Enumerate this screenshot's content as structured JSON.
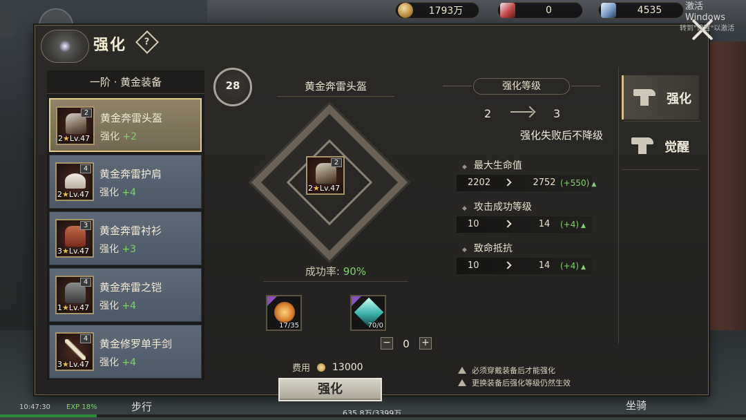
{
  "currencies": [
    {
      "icon": "gold-coin-icon",
      "value": "1793万"
    },
    {
      "icon": "red-gem-icon",
      "value": "0"
    },
    {
      "icon": "crystal-icon",
      "value": "4535"
    }
  ],
  "panel": {
    "title": "强化",
    "help_icon": "?"
  },
  "equip_list": {
    "header": "一阶 · 黄金装备",
    "items": [
      {
        "name": "黄金奔雷头盔",
        "enh_prefix": "强化",
        "enh_value": "+2",
        "badge": "2",
        "stars": "2",
        "level": "Lv.47",
        "selected": true
      },
      {
        "name": "黄金奔雷护肩",
        "enh_prefix": "强化",
        "enh_value": "+4",
        "badge": "4",
        "stars": "2",
        "level": "Lv.47",
        "selected": false
      },
      {
        "name": "黄金奔雷衬衫",
        "enh_prefix": "强化",
        "enh_value": "+3",
        "badge": "3",
        "stars": "3",
        "level": "Lv.47",
        "selected": false
      },
      {
        "name": "黄金奔雷之铠",
        "enh_prefix": "强化",
        "enh_value": "+4",
        "badge": "4",
        "stars": "1",
        "level": "Lv.47",
        "selected": false
      },
      {
        "name": "黄金修罗单手剑",
        "enh_prefix": "强化",
        "enh_value": "+4",
        "badge": "4",
        "stars": "3",
        "level": "Lv.47",
        "selected": false
      }
    ]
  },
  "center": {
    "rank": "28",
    "item_title": "黄金奔雷头盔",
    "slot": {
      "badge": "2",
      "stars": "2",
      "level": "Lv.47"
    },
    "success_label": "成功率:",
    "success_value": "90%",
    "materials": [
      {
        "icon": "gold-stone-icon",
        "count": "17/35"
      },
      {
        "icon": "blue-crystal-icon",
        "count": "70/0"
      }
    ],
    "stepper": {
      "minus": "−",
      "value": "0",
      "plus": "+"
    },
    "cost_label": "费用",
    "cost_value": "13000",
    "enhance_button": "强化"
  },
  "stats": {
    "header": "强化等级",
    "from_level": "2",
    "to_level": "3",
    "no_drop_text": "强化失败后不降级",
    "rows": [
      {
        "label": "最大生命值",
        "current": "2202",
        "next": "2752",
        "diff": "(+550)"
      },
      {
        "label": "攻击成功等级",
        "current": "10",
        "next": "14",
        "diff": "(+4)"
      },
      {
        "label": "致命抵抗",
        "current": "10",
        "next": "14",
        "diff": "(+4)"
      }
    ],
    "notes": [
      "必须穿戴装备后才能强化",
      "更换装备后强化等级仍然生效"
    ]
  },
  "tabs": [
    {
      "label": "强化",
      "icon": "anvil-icon",
      "active": true
    },
    {
      "label": "觉醒",
      "icon": "anvil-icon",
      "active": false
    }
  ],
  "hud": {
    "time": "10:47:30",
    "exp": "EXP 18%",
    "walk": "步行",
    "progress": "635.8万/3399万",
    "mount": "坐骑"
  },
  "activate_windows": {
    "line1": "激活 Windows",
    "line2": "转到\"设置\"以激活"
  }
}
